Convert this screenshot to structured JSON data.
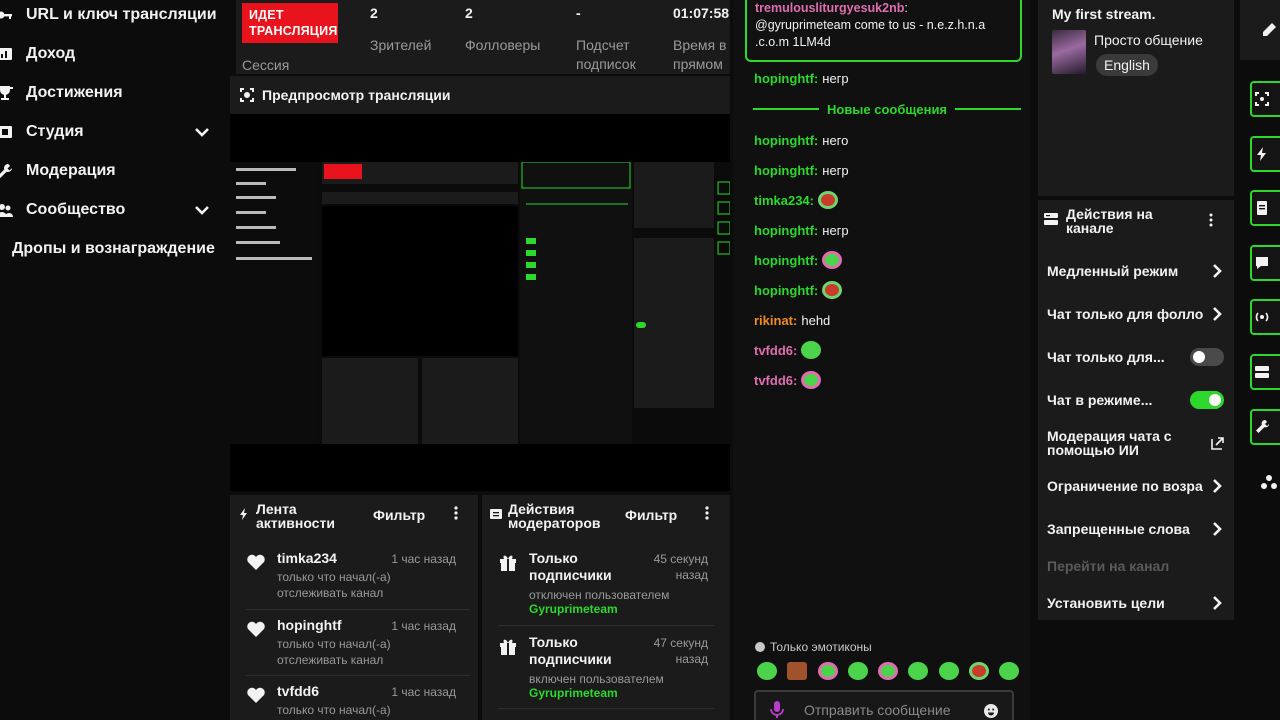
{
  "sidebar": {
    "items": [
      {
        "label": "URL и ключ трансляции",
        "icon": "key-icon"
      },
      {
        "label": "Доход",
        "icon": "chart-bar-icon"
      },
      {
        "label": "Достижения",
        "icon": "trophy-icon"
      },
      {
        "label": "Студия",
        "icon": "studio-icon",
        "expandable": true
      },
      {
        "label": "Модерация",
        "icon": "wrench-icon"
      },
      {
        "label": "Сообщество",
        "icon": "people-icon",
        "expandable": true
      },
      {
        "label": "Дропы и вознаграждение"
      }
    ]
  },
  "stats": {
    "live_badge": "ИДЕТ ТРАНСЛЯЦИЯ",
    "session_label": "Сессия",
    "items": [
      {
        "value": "2",
        "label": "Зрителей"
      },
      {
        "value": "2",
        "label": "Фолловеры"
      },
      {
        "value": "-",
        "label": "Подсчет подписок"
      },
      {
        "value": "01:07:58",
        "label": "Время в прямом"
      }
    ]
  },
  "preview": {
    "title": "Предпросмотр трансляции"
  },
  "activity": {
    "title": "Лента активности",
    "filter": "Фильтр",
    "items": [
      {
        "name": "timka234",
        "time": "1 час назад",
        "desc": "только что начал(-а) отслеживать канал"
      },
      {
        "name": "hopinghtf",
        "time": "1 час назад",
        "desc": "только что начал(-а) отслеживать канал"
      },
      {
        "name": "tvfdd6",
        "time": "1 час назад",
        "desc": "только что начал(-а)"
      }
    ]
  },
  "mod_actions": {
    "title": "Действия модераторов",
    "filter": "Фильтр",
    "items": [
      {
        "name": "Только подписчики",
        "time": "45 секунд назад",
        "desc": "отключен пользователем",
        "user": "Gyruprimeteam"
      },
      {
        "name": "Только подписчики",
        "time": "47 секунд назад",
        "desc": "включен пользователем",
        "user": "Gyruprimeteam"
      }
    ]
  },
  "chat": {
    "pinned": {
      "user": "tremulousliturgyesuk2nb",
      "text": "@gyruprimeteam come to us - n.e.z.h.n.a .c.o.m 1LM4d"
    },
    "new_messages_label": "Новые сообщения",
    "messages": [
      {
        "user": "hopinghtf",
        "text": "негр",
        "color": "#2bd82b"
      },
      {
        "user": "hopinghtf",
        "text": "него",
        "color": "#2bd82b"
      },
      {
        "user": "hopinghtf",
        "text": "негр",
        "color": "#2bd82b"
      },
      {
        "user": "timka234",
        "text": "",
        "emote": "emote-red",
        "color": "#2bd82b"
      },
      {
        "user": "hopinghtf",
        "text": "негр",
        "color": "#2bd82b"
      },
      {
        "user": "hopinghtf",
        "text": "",
        "emote": "emote-green-pink",
        "color": "#2bd82b"
      },
      {
        "user": "hopinghtf",
        "text": "",
        "emote": "emote-red",
        "color": "#2bd82b"
      },
      {
        "user": "rikinat",
        "text": "hehd",
        "color": "#f08a24"
      },
      {
        "user": "tvfdd6",
        "text": "",
        "emote": "emote-green",
        "color": "#e06db1"
      },
      {
        "user": "tvfdd6",
        "text": "",
        "emote": "emote-green-pink",
        "color": "#e06db1"
      }
    ],
    "emotes_only_label": "Только эмотиконы",
    "input_placeholder": "Отправить сообщение"
  },
  "stream_info": {
    "title": "My first stream.",
    "category": "Просто общение",
    "language": "English"
  },
  "channel_actions": {
    "title": "Действия на канале",
    "rows": [
      {
        "label": "Медленный режим",
        "control": "chevron"
      },
      {
        "label": "Чат только для фолловеров",
        "control": "chevron"
      },
      {
        "label": "Чат только для...",
        "control": "toggle",
        "on": false
      },
      {
        "label": "Чат в режиме...",
        "control": "toggle",
        "on": true
      },
      {
        "label": "Модерация чата с помощью ИИ",
        "control": "external"
      },
      {
        "label": "Ограничение по возрасту",
        "control": "chevron"
      },
      {
        "label": "Запрещенные слова",
        "control": "chevron"
      },
      {
        "label": "Перейти на канал",
        "control": "none",
        "disabled": true
      },
      {
        "label": "Установить цели",
        "control": "chevron"
      }
    ]
  },
  "colors": {
    "accent": "#2bd82b",
    "live": "#e8131d",
    "panel": "#1b1b1b",
    "background": "#0c0c0c"
  }
}
